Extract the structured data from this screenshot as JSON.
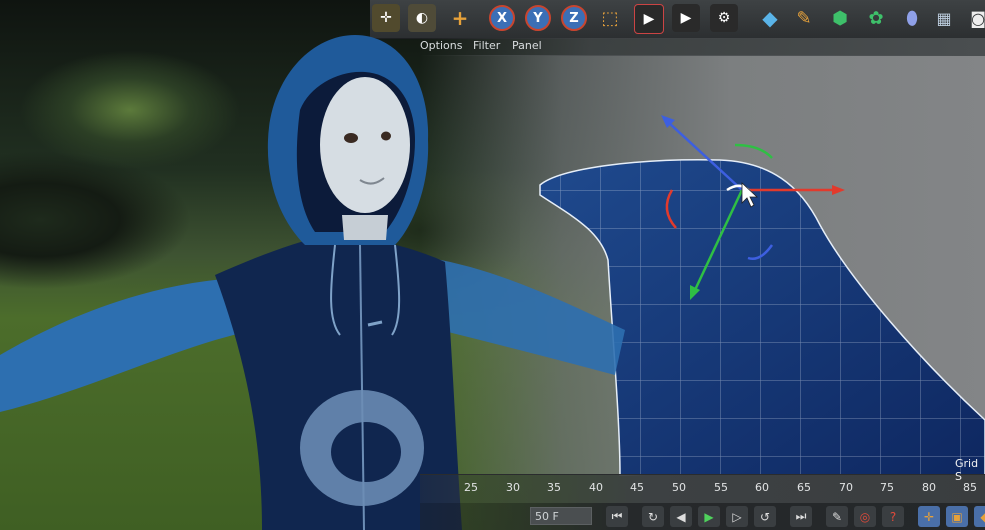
{
  "toolbar": {
    "axis_x": "X",
    "axis_y": "Y",
    "axis_z": "Z"
  },
  "menu": {
    "options": "Options",
    "filter": "Filter",
    "panel": "Panel"
  },
  "viewport": {
    "grid_label": "Grid S"
  },
  "timeline": {
    "ticks": [
      "25",
      "30",
      "35",
      "40",
      "45",
      "50",
      "55",
      "60",
      "65",
      "70",
      "75",
      "80",
      "85"
    ],
    "current_frame": "50 F"
  },
  "colors": {
    "hoodie": "#1a3a78",
    "sleeve": "#2d6fb0",
    "mesh": "#13306a",
    "axis_x_arrow": "#e23a2c",
    "axis_y_arrow": "#2fbf44",
    "axis_z_arrow": "#3d5fe0"
  }
}
